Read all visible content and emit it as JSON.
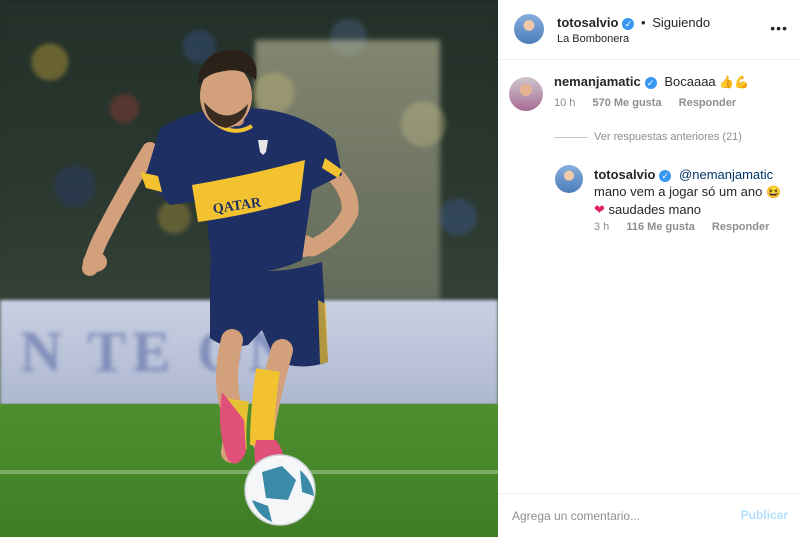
{
  "photo": {
    "board_text": "N  TE  ON",
    "shirt_sponsor": "QATAR AIRWAYS"
  },
  "header": {
    "username": "totosalvio",
    "separator": "•",
    "follow_status": "Siguiendo",
    "location": "La Bombonera",
    "more": "•••"
  },
  "comment_main": {
    "username": "nemanjamatic",
    "text": "Bocaaaa",
    "emoji": "👍💪",
    "time": "10 h",
    "likes": "570 Me gusta",
    "reply": "Responder"
  },
  "view_replies": "Ver respuestas anteriores (21)",
  "comment_reply": {
    "username": "totosalvio",
    "mention": "@nemanjamatic",
    "line1": "mano vem a jogar só um ano",
    "emoji1": "😆",
    "heart": "❤",
    "line2": "saudades mano",
    "time": "3 h",
    "likes": "116 Me gusta",
    "reply": "Responder"
  },
  "footer": {
    "placeholder": "Agrega un comentario...",
    "publish": "Publicar"
  },
  "colors": {
    "verified": "#3897f0",
    "mention": "#003569",
    "publish_disabled": "#b2dffc",
    "meta_gray": "#8e8e8e",
    "boca_blue": "#1d2f63",
    "boca_yellow": "#f2c230"
  }
}
